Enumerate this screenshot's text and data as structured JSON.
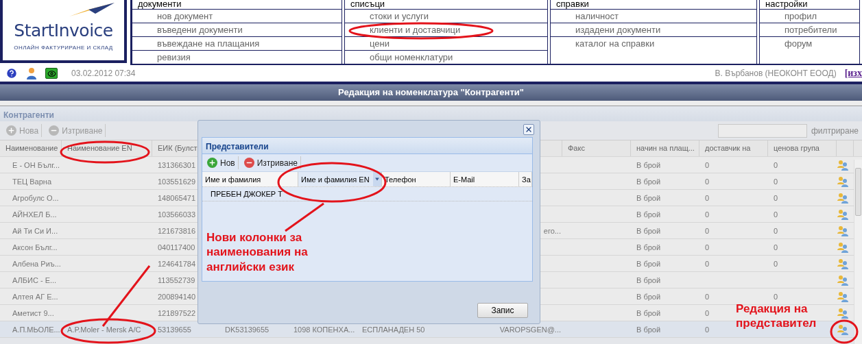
{
  "logo": {
    "name": "StartInvoice",
    "tagline": "ОНЛАЙН ФАКТУРИРАНЕ И СКЛАД"
  },
  "menu": [
    {
      "heading": "документи",
      "items": [
        {
          "label": "нов документ"
        },
        {
          "label": "въведени документи"
        },
        {
          "label": "въвеждане на плащания"
        },
        {
          "label": "ревизия"
        }
      ]
    },
    {
      "heading": "списъци",
      "items": [
        {
          "label": "стоки и услуги"
        },
        {
          "label": "клиенти и доставчици"
        },
        {
          "label": "цени"
        },
        {
          "label": "общи номенклатури"
        }
      ]
    },
    {
      "heading": "справки",
      "items": [
        {
          "label": "наличност"
        },
        {
          "label": "издадени документи"
        },
        {
          "label": "каталог на справки"
        }
      ]
    },
    {
      "heading": "настройки",
      "items": [
        {
          "label": "профил"
        },
        {
          "label": "потребители"
        },
        {
          "label": "форум"
        }
      ]
    }
  ],
  "status": {
    "datetime": "03.02.2012 07:34",
    "user": "В. Върбанов (НЕОКОНТ ЕООД)",
    "logout": "[изх"
  },
  "page_title": "Редакция на номенклатура \"Контрагенти\"",
  "panel": {
    "title": "Контрагенти",
    "toolbar": [
      {
        "label": "Нова",
        "kind": "add",
        "disabled": true
      },
      {
        "label": "Изтриване",
        "kind": "delete",
        "disabled": true
      }
    ],
    "filter": {
      "label": "филтриране"
    },
    "columns": [
      "Наименование",
      "Наименование EN",
      "ЕИК (Булст",
      null,
      null,
      null,
      null,
      "Факс",
      "начин на плащ...",
      "доставчик на",
      "ценова група"
    ],
    "rows": [
      {
        "selected": false,
        "cells": [
          "Е - ОН Бълг...",
          null,
          "131366301",
          null,
          null,
          null,
          null,
          null,
          "В брой",
          "0",
          "0"
        ]
      },
      {
        "selected": false,
        "cells": [
          "ТЕЦ Варна",
          null,
          "103551629",
          null,
          null,
          null,
          null,
          null,
          "В брой",
          "0",
          "0"
        ]
      },
      {
        "selected": false,
        "cells": [
          "Агробулс О...",
          null,
          "148065471",
          null,
          null,
          null,
          null,
          null,
          "В брой",
          "0",
          "0"
        ]
      },
      {
        "selected": false,
        "cells": [
          "АЙНХЕЛ Б...",
          null,
          "103566033",
          null,
          null,
          null,
          null,
          null,
          "В брой",
          "0",
          "0"
        ]
      },
      {
        "selected": false,
        "cells": [
          "Ай Ти Си И...",
          null,
          "121673816",
          null,
          null,
          null,
          "его...",
          null,
          "В брой",
          "0",
          "0"
        ]
      },
      {
        "selected": false,
        "cells": [
          "Аксон Бълг...",
          null,
          "040117400",
          null,
          null,
          null,
          null,
          null,
          "В брой",
          "0",
          "0"
        ]
      },
      {
        "selected": false,
        "cells": [
          "Албена Риъ...",
          null,
          "124641784",
          null,
          null,
          null,
          null,
          null,
          "В брой",
          "0",
          "0"
        ]
      },
      {
        "selected": false,
        "cells": [
          "АЛБИС - Е...",
          null,
          "113552739",
          null,
          null,
          null,
          null,
          null,
          "В брой",
          null,
          null
        ]
      },
      {
        "selected": false,
        "cells": [
          "Алтея АГ Е...",
          null,
          "200894140",
          null,
          null,
          null,
          null,
          null,
          "В брой",
          "0",
          "0"
        ]
      },
      {
        "selected": false,
        "cells": [
          "Аметист 9...",
          null,
          "121897522",
          null,
          null,
          null,
          null,
          null,
          "В брой",
          "0",
          null
        ]
      },
      {
        "selected": true,
        "cells": [
          "А.П.МЬОЛЕ...",
          "A.P.Moler - Mersk A/C",
          "53139655",
          "DK53139655",
          "1098 КОПЕНХА...",
          "ЕСПЛАНАДЕН 50",
          "VAROPSGEN@...",
          null,
          "В брой",
          "0",
          null
        ]
      }
    ]
  },
  "dialog": {
    "title": "Представители",
    "toolbar": [
      {
        "label": "Нов",
        "kind": "add",
        "disabled": false
      },
      {
        "label": "Изтриване",
        "kind": "delete",
        "disabled": false
      }
    ],
    "columns": [
      {
        "label": "Име и фамилия",
        "active": false
      },
      {
        "label": "Име и фамилия EN",
        "active": true
      },
      {
        "label": "Телефон",
        "active": false
      },
      {
        "label": "E-Mail",
        "active": false
      },
      {
        "label": "За",
        "active": false
      }
    ],
    "rows": [
      [
        "ПРЕБЕН ДЖОКЕР Т"
      ]
    ],
    "save": "Запис"
  },
  "notes": [
    {
      "text": "Нови колонки за наименования на английски език"
    },
    {
      "lines": [
        "Редакция на",
        "представител"
      ]
    }
  ]
}
